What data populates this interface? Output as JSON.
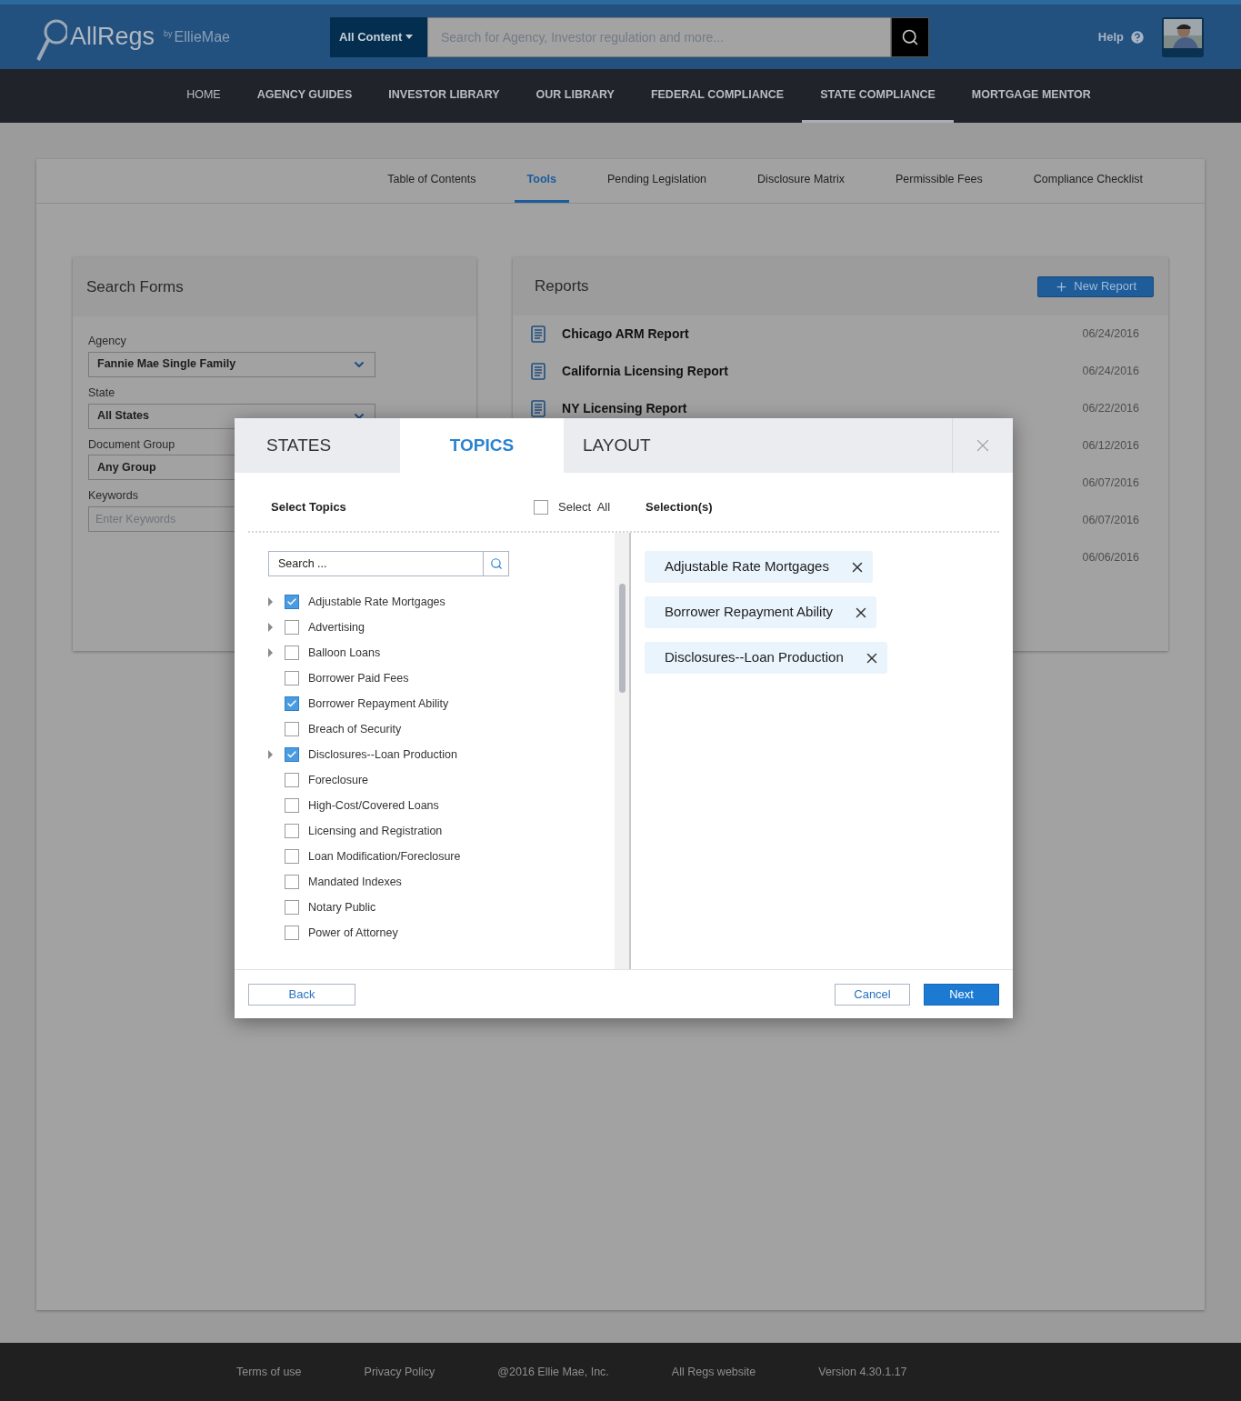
{
  "header": {
    "logo": "AllRegs",
    "logo_by": "by",
    "logo_brand": "EllieMae",
    "content_filter": "All Content",
    "search_placeholder": "Search for Agency, Investor regulation and more...",
    "help": "Help"
  },
  "nav": [
    {
      "label": "HOME",
      "selected": false
    },
    {
      "label": "AGENCY GUIDES",
      "selected": false
    },
    {
      "label": "INVESTOR LIBRARY",
      "selected": false
    },
    {
      "label": "OUR LIBRARY",
      "selected": false
    },
    {
      "label": "FEDERAL COMPLIANCE",
      "selected": false
    },
    {
      "label": "STATE COMPLIANCE",
      "selected": true
    },
    {
      "label": "MORTGAGE MENTOR",
      "selected": false
    }
  ],
  "tabs": [
    {
      "label": "Table of Contents",
      "selected": false
    },
    {
      "label": "Tools",
      "selected": true
    },
    {
      "label": "Pending Legislation",
      "selected": false
    },
    {
      "label": "Disclosure Matrix",
      "selected": false
    },
    {
      "label": "Permissible Fees",
      "selected": false
    },
    {
      "label": "Compliance Checklist",
      "selected": false
    }
  ],
  "search_forms": {
    "title": "Search Forms",
    "fields": [
      {
        "label": "Agency",
        "value": "Fannie Mae Single Family",
        "kind": "select"
      },
      {
        "label": "State",
        "value": "All States",
        "kind": "select"
      },
      {
        "label": "Document Group",
        "value": "Any Group",
        "kind": "select"
      },
      {
        "label": "Keywords",
        "placeholder": "Enter Keywords",
        "kind": "text"
      }
    ]
  },
  "reports": {
    "title": "Reports",
    "new_button": "New Report",
    "rows": [
      {
        "name": "Chicago ARM Report",
        "date": "06/24/2016"
      },
      {
        "name": "California Licensing Report",
        "date": "06/24/2016"
      },
      {
        "name": "NY Licensing Report",
        "date": "06/22/2016"
      },
      {
        "date": "06/12/2016"
      },
      {
        "date": "06/07/2016"
      },
      {
        "date": "06/07/2016"
      },
      {
        "date": "06/06/2016"
      }
    ]
  },
  "modal": {
    "steps": [
      {
        "label": "STATES",
        "selected": false
      },
      {
        "label": "TOPICS",
        "selected": true
      },
      {
        "label": "LAYOUT",
        "selected": false
      }
    ],
    "select_topics": "Select Topics",
    "select_all": {
      "label": "Select  All",
      "checked": false
    },
    "selections_title": "Selection(s)",
    "search_placeholder": "Search ...",
    "topics": [
      {
        "label": "Adjustable Rate Mortgages",
        "checked": true,
        "expandable": true
      },
      {
        "label": "Advertising",
        "checked": false,
        "expandable": true
      },
      {
        "label": "Balloon Loans",
        "checked": false,
        "expandable": true
      },
      {
        "label": "Borrower Paid Fees",
        "checked": false,
        "expandable": false
      },
      {
        "label": "Borrower Repayment Ability",
        "checked": true,
        "expandable": false
      },
      {
        "label": "Breach of Security",
        "checked": false,
        "expandable": false
      },
      {
        "label": "Disclosures--Loan Production",
        "checked": true,
        "expandable": true
      },
      {
        "label": "Foreclosure",
        "checked": false,
        "expandable": false
      },
      {
        "label": "High-Cost/Covered Loans",
        "checked": false,
        "expandable": false
      },
      {
        "label": "Licensing and Registration",
        "checked": false,
        "expandable": false
      },
      {
        "label": "Loan Modification/Foreclosure",
        "checked": false,
        "expandable": false
      },
      {
        "label": "Mandated Indexes",
        "checked": false,
        "expandable": false
      },
      {
        "label": "Notary Public",
        "checked": false,
        "expandable": false
      },
      {
        "label": "Power of Attorney",
        "checked": false,
        "expandable": false
      }
    ],
    "selections": [
      "Adjustable Rate Mortgages",
      "Borrower Repayment Ability",
      "Disclosures--Loan Production"
    ],
    "back": "Back",
    "cancel": "Cancel",
    "next": "Next"
  },
  "footer": [
    "Terms of use",
    "Privacy Policy",
    "@2016 Ellie Mae, Inc.",
    "All Regs website",
    "Version 4.30.1.17"
  ]
}
